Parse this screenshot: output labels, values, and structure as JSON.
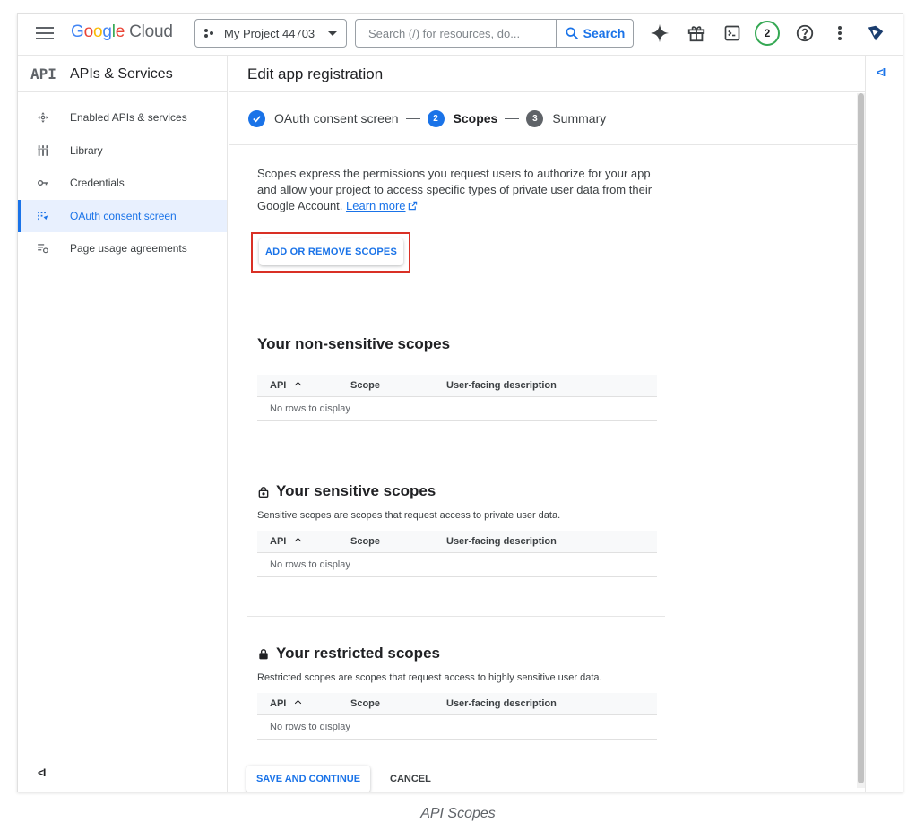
{
  "topbar": {
    "logo_google_letters": [
      "G",
      "o",
      "o",
      "g",
      "l",
      "e"
    ],
    "logo_cloud": "Cloud",
    "project_name": "My Project 44703",
    "search_placeholder": "Search (/) for resources, do...",
    "search_button": "Search",
    "notifications_count": "2",
    "icons": [
      "menu-icon",
      "sparkle-icon",
      "gift-icon",
      "terminal-icon",
      "help-icon",
      "more-vert-icon",
      "account-avatar-icon"
    ]
  },
  "sidebar": {
    "api_logo": "API",
    "title": "APIs & Services",
    "items": [
      {
        "label": "Enabled APIs & services",
        "icon": "enabled-apis-icon",
        "active": false
      },
      {
        "label": "Library",
        "icon": "library-icon",
        "active": false
      },
      {
        "label": "Credentials",
        "icon": "key-icon",
        "active": false
      },
      {
        "label": "OAuth consent screen",
        "icon": "oauth-icon",
        "active": true
      },
      {
        "label": "Page usage agreements",
        "icon": "agreements-icon",
        "active": false
      }
    ],
    "collapse_label": "<I"
  },
  "main": {
    "title": "Edit app registration",
    "steps": [
      {
        "number": "",
        "label": "OAuth consent screen",
        "state": "done"
      },
      {
        "number": "2",
        "label": "Scopes",
        "state": "current"
      },
      {
        "number": "3",
        "label": "Summary",
        "state": "todo"
      }
    ],
    "intro_text": "Scopes express the permissions you request users to authorize for your app and allow your project to access specific types of private user data from their Google Account.",
    "learn_more": "Learn more",
    "add_scopes_button": "ADD OR REMOVE SCOPES",
    "sections": [
      {
        "title": "Your non-sensitive scopes",
        "description": "",
        "empty_text": "No rows to display"
      },
      {
        "title": "Your sensitive scopes",
        "description": "Sensitive scopes are scopes that request access to private user data.",
        "empty_text": "No rows to display"
      },
      {
        "title": "Your restricted scopes",
        "description": "Restricted scopes are scopes that request access to highly sensitive user data.",
        "empty_text": "No rows to display"
      }
    ],
    "table_headers": {
      "api": "API",
      "scope": "Scope",
      "description": "User-facing description"
    },
    "save_button": "SAVE AND CONTINUE",
    "cancel_button": "CANCEL"
  },
  "right_panel": {
    "expand_label": "<I"
  },
  "caption": "API Scopes",
  "colors": {
    "accent": "#1a73e8",
    "highlight_border": "#d93025",
    "active_bg": "#e8f0fe",
    "badge_ring": "#34a853"
  }
}
